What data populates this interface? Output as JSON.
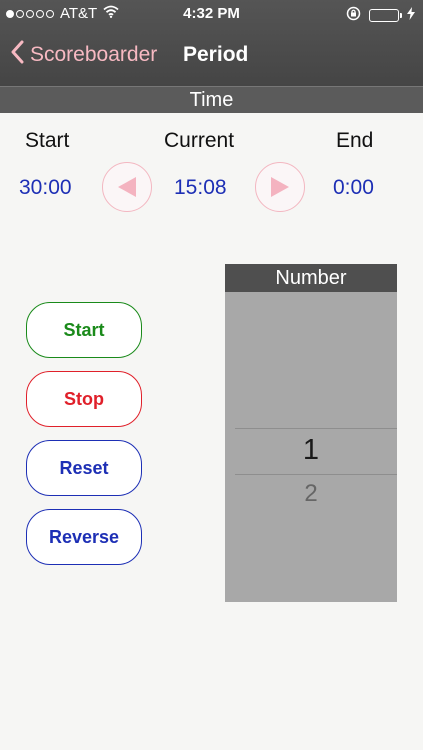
{
  "status": {
    "carrier": "AT&T",
    "time": "4:32 PM"
  },
  "nav": {
    "back_label": "Scoreboarder",
    "title": "Period"
  },
  "section": {
    "title": "Time"
  },
  "time": {
    "start_label": "Start",
    "current_label": "Current",
    "end_label": "End",
    "start_value": "30:00",
    "current_value": "15:08",
    "end_value": "0:00"
  },
  "controls": {
    "start": "Start",
    "stop": "Stop",
    "reset": "Reset",
    "reverse": "Reverse"
  },
  "picker": {
    "title": "Number",
    "selected": "1",
    "next": "2"
  },
  "colors": {
    "green": "#1a8a1a",
    "red": "#e0202a",
    "blue": "#1d2fb5",
    "pink": "#f3b7c1"
  }
}
